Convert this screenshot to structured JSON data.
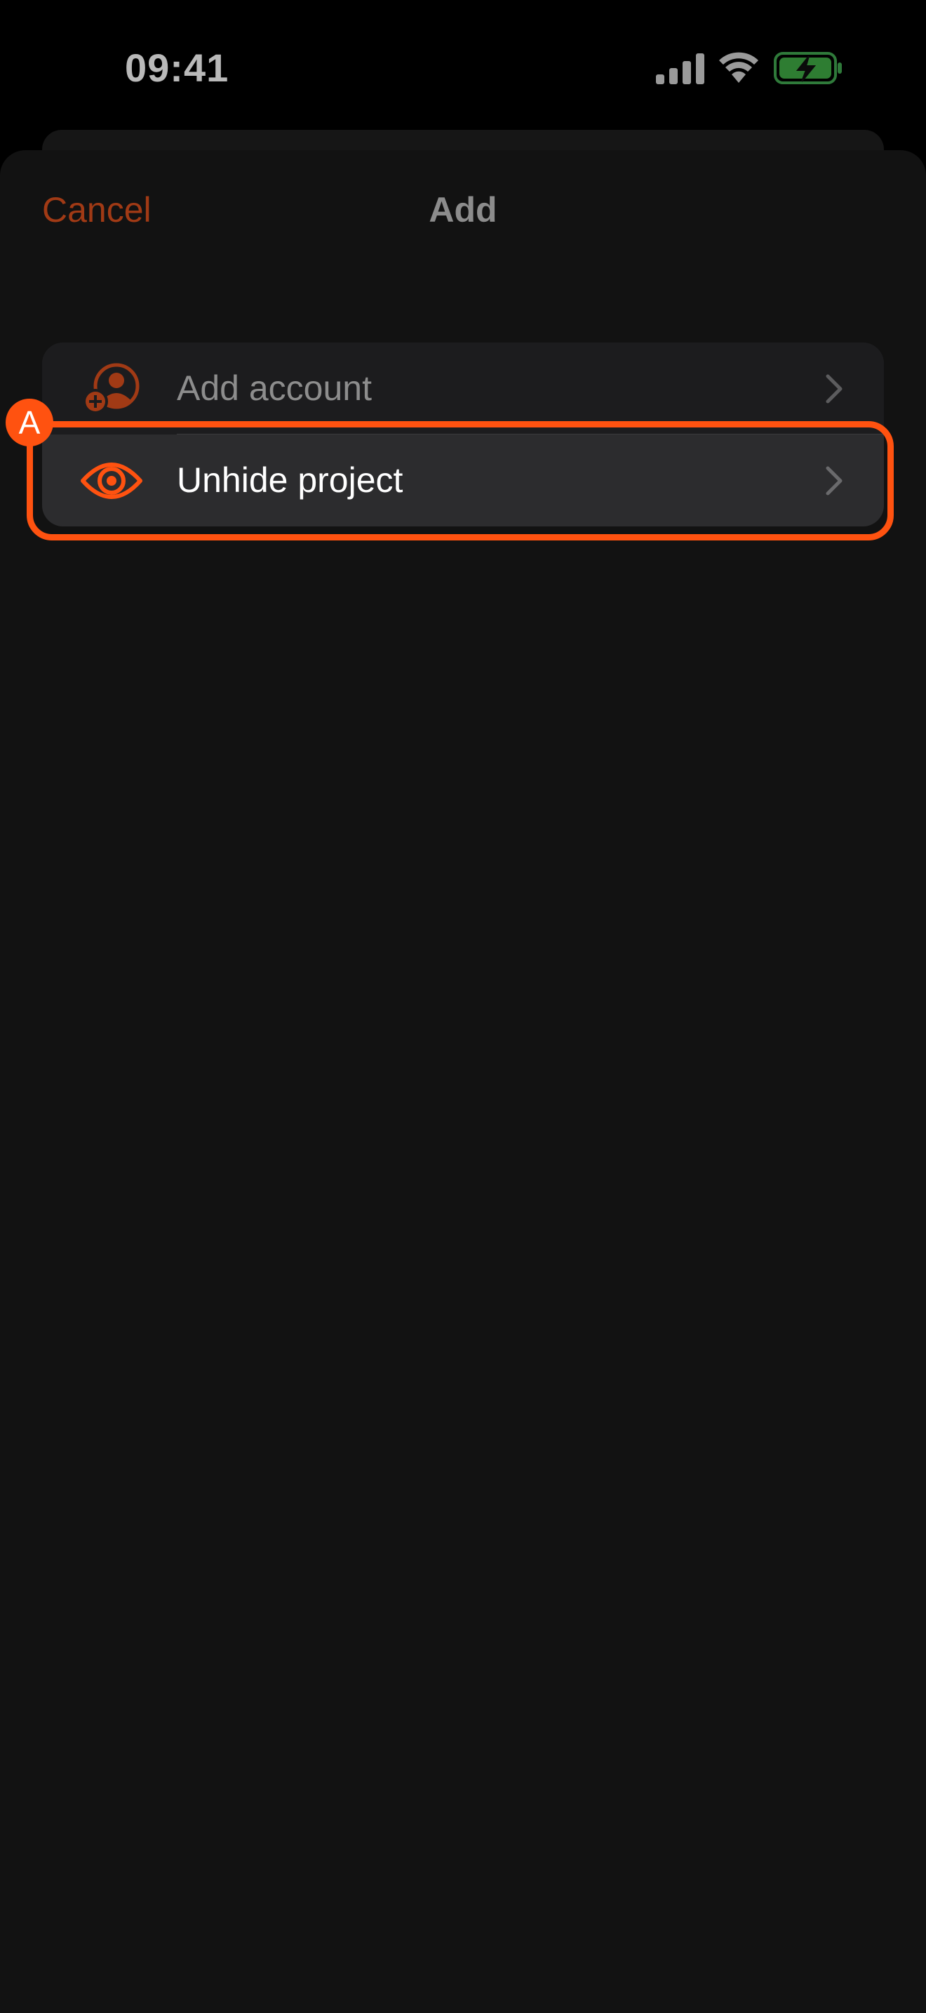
{
  "status_bar": {
    "time": "09:41",
    "icons": [
      "cellular-signal-icon",
      "wifi-icon",
      "battery-charging-icon"
    ]
  },
  "nav": {
    "cancel_label": "Cancel",
    "title": "Add"
  },
  "list": {
    "items": [
      {
        "label": "Add account",
        "icon": "add-account-icon"
      },
      {
        "label": "Unhide project",
        "icon": "eye-icon"
      }
    ]
  },
  "annotation": {
    "badge_label": "A"
  },
  "colors": {
    "accent": "#ff5210",
    "cancel_dim": "#a13a15",
    "sheet_bg": "#121212",
    "row_bg": "#1c1c1e",
    "row_selected_bg": "#2c2c2e",
    "battery_green": "#34c759"
  }
}
